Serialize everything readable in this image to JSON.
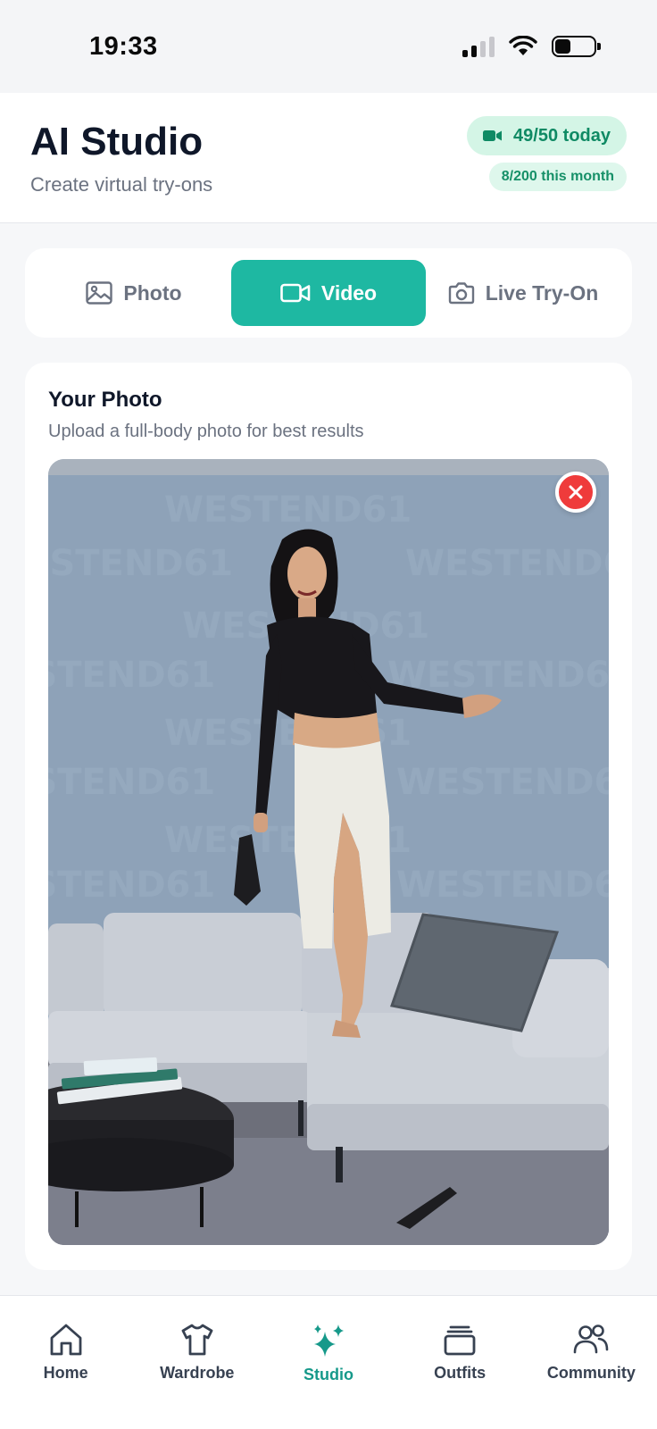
{
  "status_bar": {
    "time": "19:33"
  },
  "header": {
    "title": "AI Studio",
    "subtitle": "Create virtual try-ons",
    "quota_day": "49/50 today",
    "quota_month": "8/200 this month"
  },
  "tabs": [
    {
      "label": "Photo",
      "icon": "image-icon",
      "active": false
    },
    {
      "label": "Video",
      "icon": "video-camera-icon",
      "active": true
    },
    {
      "label": "Live Try-On",
      "icon": "camera-icon",
      "active": false
    }
  ],
  "photo_card": {
    "title": "Your Photo",
    "subtitle": "Upload a full-body photo for best results",
    "watermark": "WESTEND61"
  },
  "bottom_nav": [
    {
      "label": "Home",
      "icon": "home-icon",
      "active": false
    },
    {
      "label": "Wardrobe",
      "icon": "tshirt-icon",
      "active": false
    },
    {
      "label": "Studio",
      "icon": "sparkles-icon",
      "active": true
    },
    {
      "label": "Outfits",
      "icon": "stacked-cards-icon",
      "active": false
    },
    {
      "label": "Community",
      "icon": "people-icon",
      "active": false
    }
  ],
  "colors": {
    "accent": "#1eb8a2",
    "accent_text": "#16998a",
    "quota_bg": "#d4f5e6",
    "remove": "#ef3b3b"
  }
}
